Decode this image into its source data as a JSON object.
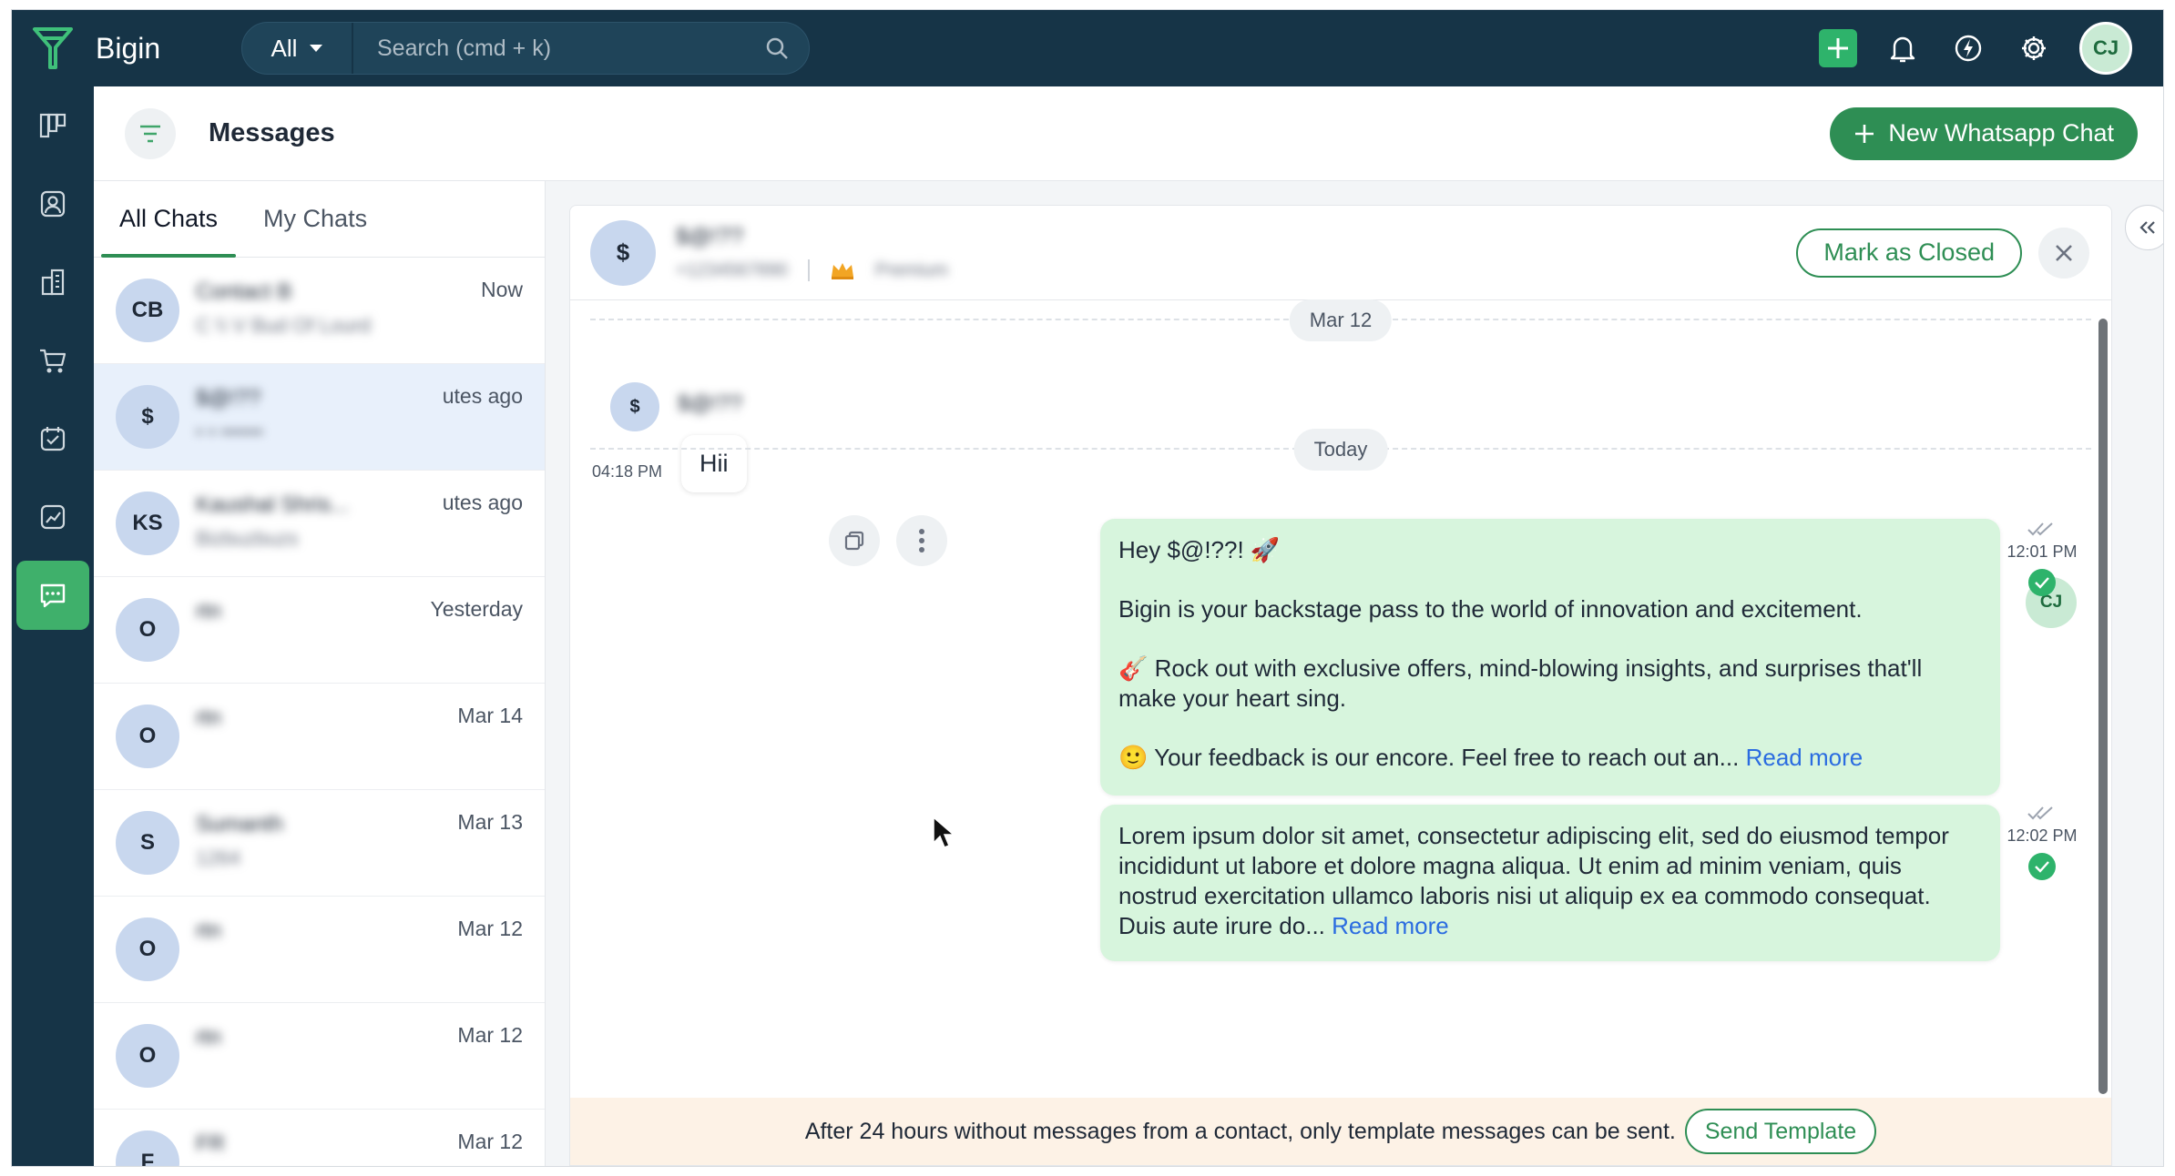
{
  "app": {
    "brand": "Bigin",
    "colors": {
      "topbar": "#163447",
      "accent": "#2e8e54",
      "outgoing_bubble": "#d7f5dd",
      "notice_bar": "#fdf2e6"
    }
  },
  "topbar": {
    "search_scope": "All",
    "search_placeholder": "Search (cmd + k)",
    "icons": [
      "add-icon",
      "bell-icon",
      "lightning-icon",
      "gear-icon"
    ],
    "user_initials": "CJ"
  },
  "rail": {
    "items": [
      {
        "name": "pipelines-icon",
        "active": false
      },
      {
        "name": "contacts-icon",
        "active": false
      },
      {
        "name": "companies-icon",
        "active": false
      },
      {
        "name": "products-icon",
        "active": false
      },
      {
        "name": "activities-icon",
        "active": false
      },
      {
        "name": "reports-icon",
        "active": false
      },
      {
        "name": "messages-icon",
        "active": true
      }
    ]
  },
  "header": {
    "title": "Messages",
    "new_chat_label": "New Whatsapp Chat"
  },
  "chatlist": {
    "tabs": [
      {
        "label": "All Chats",
        "active": true
      },
      {
        "label": "My Chats",
        "active": false
      }
    ],
    "items": [
      {
        "initials": "CB",
        "name": "Contact B",
        "preview": "C \\\\ V Bud Of Lourd",
        "time": "Now",
        "active": false
      },
      {
        "initials": "$",
        "name": "$@!??",
        "preview": "• • ••••••",
        "time": "utes ago",
        "active": true
      },
      {
        "initials": "KS",
        "name": "Kaushal Shris...",
        "preview": "Bizbuzbuzs",
        "time": "utes ago",
        "active": false
      },
      {
        "initials": "O",
        "name": "rtn",
        "preview": "",
        "time": "Yesterday",
        "active": false
      },
      {
        "initials": "O",
        "name": "rtn",
        "preview": "",
        "time": "Mar 14",
        "active": false
      },
      {
        "initials": "S",
        "name": "Sumanth",
        "preview": "1264",
        "time": "Mar 13",
        "active": false
      },
      {
        "initials": "O",
        "name": "rtn",
        "preview": "",
        "time": "Mar 12",
        "active": false
      },
      {
        "initials": "O",
        "name": "rtn",
        "preview": "",
        "time": "Mar 12",
        "active": false
      },
      {
        "initials": "F",
        "name": "FR",
        "preview": "",
        "time": "Mar 12",
        "active": false
      }
    ]
  },
  "conversation": {
    "contact": {
      "initials": "$",
      "name": "$@!??",
      "phone": "+1234567890",
      "plan": "Premium"
    },
    "close_label": "Mark as Closed",
    "day_separators": [
      "Mar 12",
      "Today"
    ],
    "incoming": {
      "author_initials": "$",
      "author_name": "$@!??",
      "time": "04:18 PM",
      "text": "Hii"
    },
    "outgoing_author": "C J",
    "outgoing_avatar": "CJ",
    "outgoing": [
      {
        "paragraphs": [
          "Hey $@!??! 🚀",
          "Bigin is your backstage pass to the world of innovation and excitement.",
          "🎸 Rock out with exclusive offers, mind-blowing insights, and surprises that'll make your heart sing.",
          "🙂 Your feedback is our encore. Feel free to reach out an..."
        ],
        "read_more": "Read more",
        "time": "12:01 PM"
      },
      {
        "paragraphs": [
          "Lorem ipsum dolor sit amet, consectetur adipiscing elit, sed do eiusmod tempor incididunt ut labore et dolore magna aliqua. Ut enim ad minim veniam, quis nostrud exercitation ullamco laboris nisi ut aliquip ex ea commodo consequat. Duis aute irure do..."
        ],
        "read_more": "Read more",
        "time": "12:02 PM"
      }
    ],
    "footer": {
      "notice": "After 24 hours without messages from a contact, only template messages can be sent.",
      "button": "Send Template"
    }
  }
}
